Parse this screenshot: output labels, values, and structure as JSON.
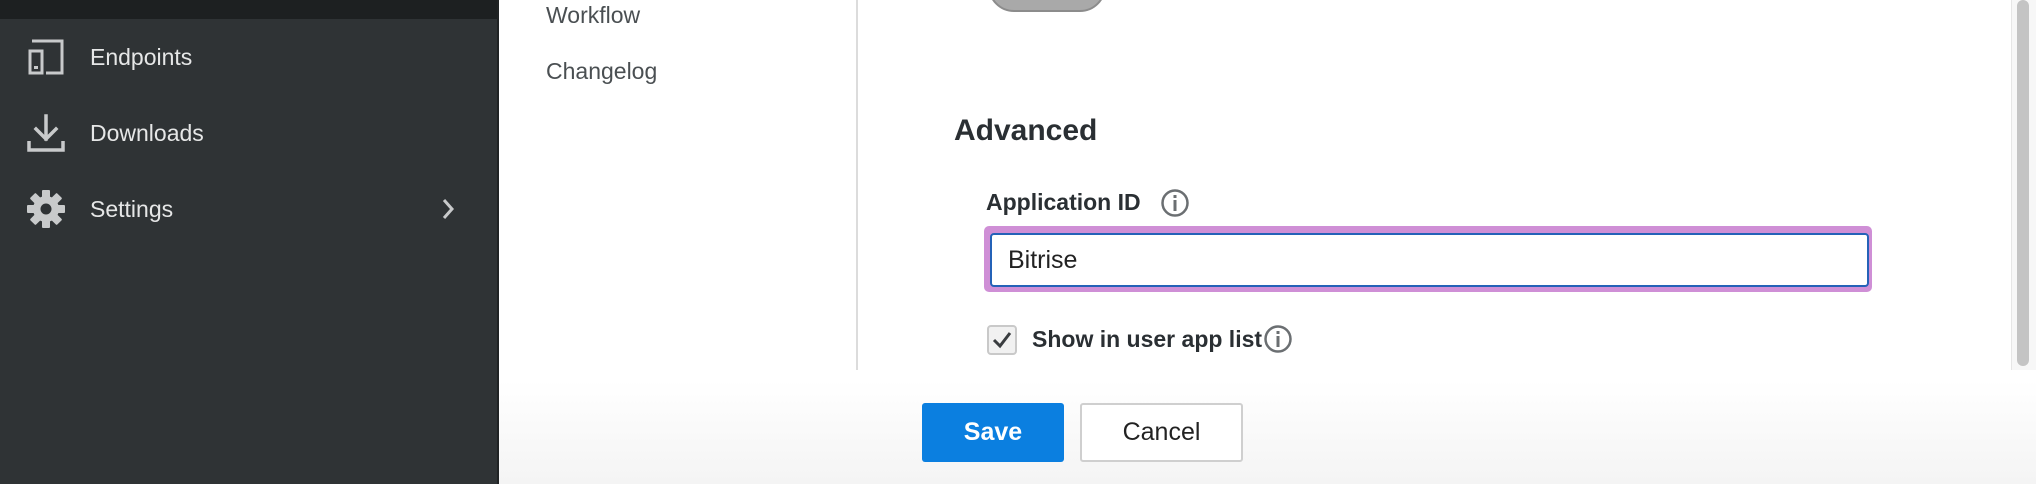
{
  "sidebar": {
    "items": [
      {
        "label": "Endpoints",
        "icon": "endpoints-icon"
      },
      {
        "label": "Downloads",
        "icon": "download-icon"
      },
      {
        "label": "Settings",
        "icon": "gear-icon",
        "has_submenu": true
      }
    ]
  },
  "subnav": {
    "items": [
      {
        "label": "Workflow"
      },
      {
        "label": "Changelog"
      }
    ]
  },
  "main": {
    "section_title": "Advanced",
    "application_id": {
      "label": "Application ID",
      "value": "Bitrise"
    },
    "show_in_list": {
      "label": "Show in user app list",
      "checked": true
    }
  },
  "footer": {
    "save_label": "Save",
    "cancel_label": "Cancel"
  },
  "colors": {
    "sidebar_bg": "#2f3335",
    "primary": "#0b7fe0",
    "focus_ring": "#cf8fd6"
  }
}
